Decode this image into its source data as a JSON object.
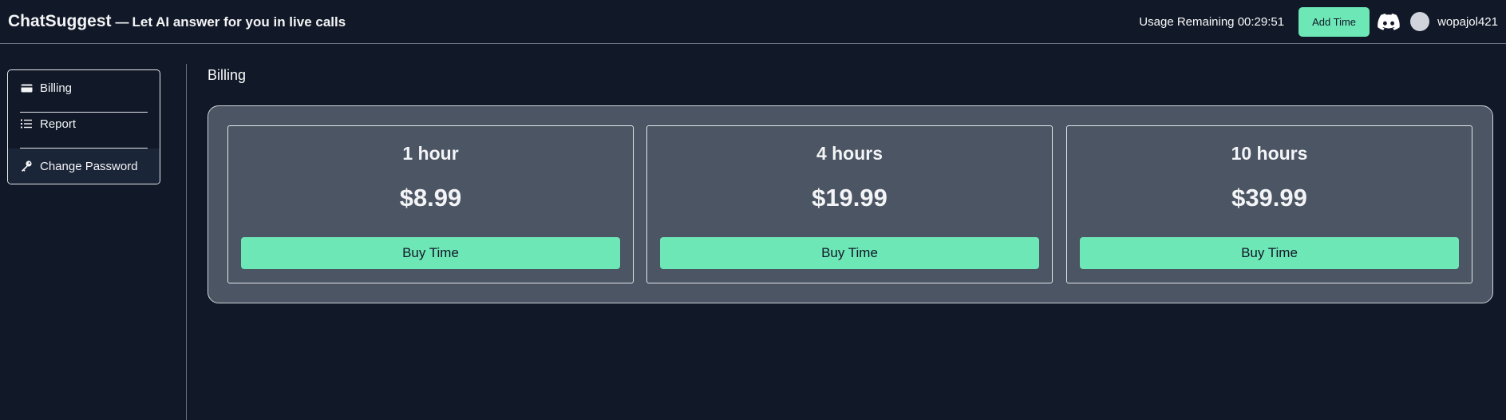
{
  "header": {
    "brand_name": "ChatSuggest",
    "brand_separator": "—",
    "tagline": "Let AI answer for you in live calls",
    "usage_label": "Usage Remaining 00:29:51",
    "add_time_label": "Add Time",
    "discord_icon": "discord-icon",
    "username": "wopajol421"
  },
  "sidebar": {
    "items": [
      {
        "label": "Billing",
        "icon": "credit-card-icon"
      },
      {
        "label": "Report",
        "icon": "list-icon"
      },
      {
        "label": "Change Password",
        "icon": "key-icon"
      }
    ],
    "active": "Change Password"
  },
  "main": {
    "title": "Billing",
    "plans": [
      {
        "duration": "1 hour",
        "price": "$8.99",
        "button_label": "Buy Time"
      },
      {
        "duration": "4 hours",
        "price": "$19.99",
        "button_label": "Buy Time"
      },
      {
        "duration": "10 hours",
        "price": "$39.99",
        "button_label": "Buy Time"
      }
    ]
  },
  "colors": {
    "background": "#111827",
    "accent": "#6ee7b7",
    "panel": "#4b5563"
  }
}
